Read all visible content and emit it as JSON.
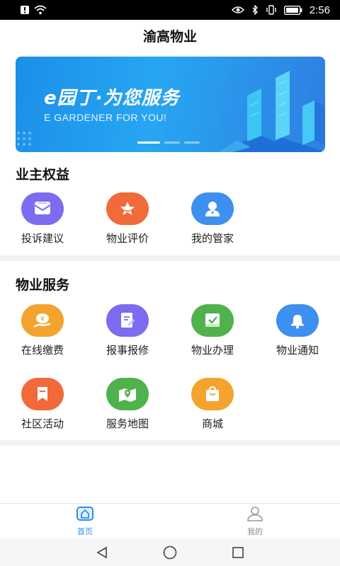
{
  "status_bar": {
    "time": "2:56"
  },
  "header": {
    "title": "渝高物业"
  },
  "banner": {
    "title": "e园丁·为您服务",
    "subtitle": "E GARDENER FOR YOU!",
    "gradient_start": "#1b8fe8",
    "gradient_end": "#2f7fe0"
  },
  "owner_rights": {
    "title": "业主权益",
    "items": [
      {
        "label": "投诉建议",
        "icon": "complaint-icon",
        "color": "#7b6cf0"
      },
      {
        "label": "物业评价",
        "icon": "star-rating-icon",
        "color": "#f2693a"
      },
      {
        "label": "我的管家",
        "icon": "butler-icon",
        "color": "#3d8ff0"
      }
    ]
  },
  "property_services": {
    "title": "物业服务",
    "items": [
      {
        "label": "在线缴费",
        "icon": "payment-icon",
        "color": "#f4a42e"
      },
      {
        "label": "报事报修",
        "icon": "repair-icon",
        "color": "#7b6cf0"
      },
      {
        "label": "物业办理",
        "icon": "handling-icon",
        "color": "#4fb24d"
      },
      {
        "label": "物业通知",
        "icon": "bell-icon",
        "color": "#3d8ff0"
      },
      {
        "label": "社区活动",
        "icon": "community-icon",
        "color": "#f2693a"
      },
      {
        "label": "服务地图",
        "icon": "map-icon",
        "color": "#4fb24d"
      },
      {
        "label": "商城",
        "icon": "shopping-bag-icon",
        "color": "#f4a42e"
      }
    ]
  },
  "tabbar": {
    "tabs": [
      {
        "label": "首页",
        "icon": "home-icon",
        "active": true
      },
      {
        "label": "我的",
        "icon": "user-icon",
        "active": false
      }
    ],
    "active_color": "#2a8ef0"
  },
  "system_nav": [
    "back-icon",
    "home-circle-icon",
    "recents-icon"
  ]
}
